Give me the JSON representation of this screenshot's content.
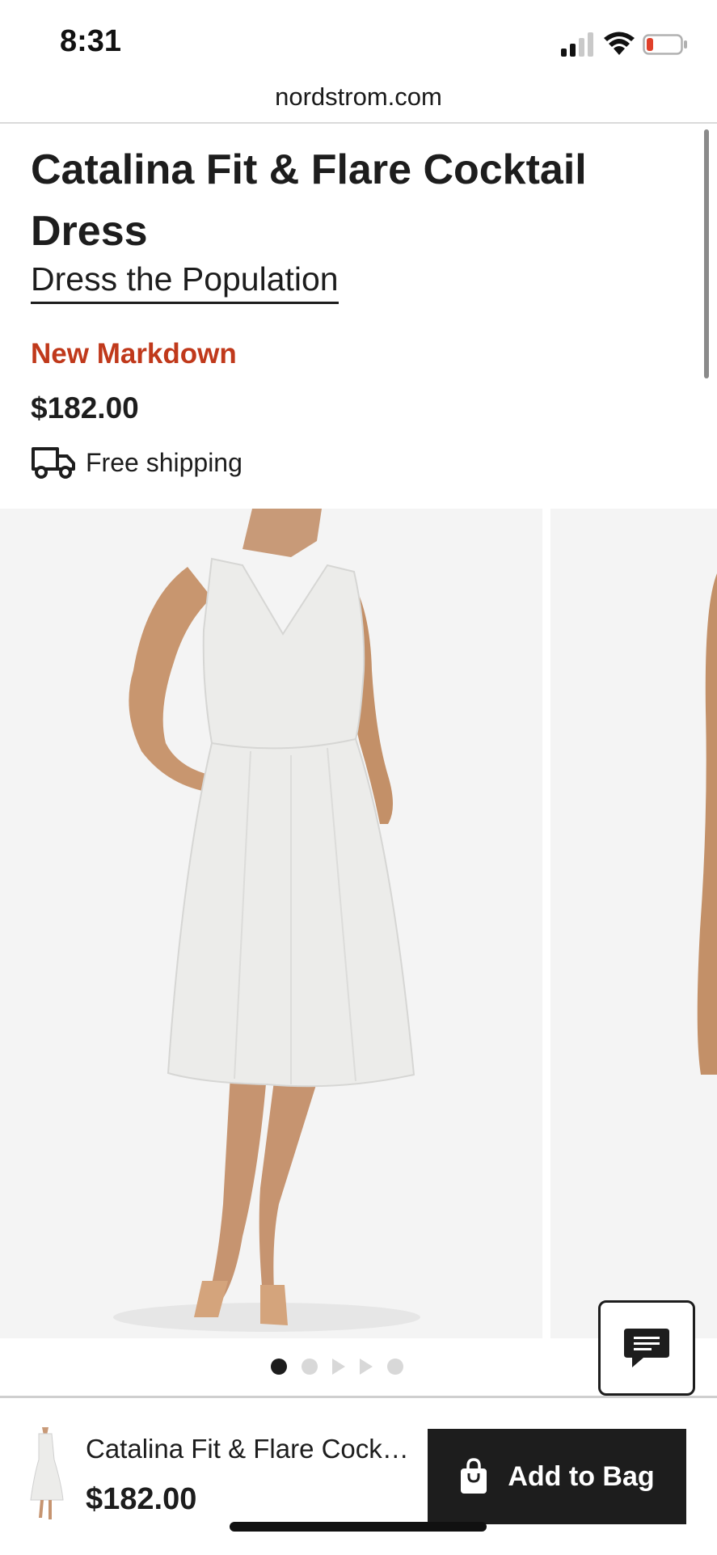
{
  "status_bar": {
    "time": "8:31"
  },
  "browser": {
    "url": "nordstrom.com"
  },
  "product": {
    "title": "Catalina Fit & Flare Cocktail Dress",
    "brand": "Dress the Population",
    "markdown_label": "New Markdown",
    "price": "$182.00",
    "shipping": "Free shipping"
  },
  "gallery": {
    "image_count": 5,
    "current_index": 1
  },
  "sticky_bar": {
    "title": "Catalina Fit & Flare Cockt...",
    "price": "$182.00",
    "add_to_bag_label": "Add to Bag"
  },
  "colors": {
    "markdown": "#c0391b",
    "text": "#1d1d1d",
    "button_bg": "#1d1d1d",
    "photo_bg": "#f4f4f4"
  }
}
